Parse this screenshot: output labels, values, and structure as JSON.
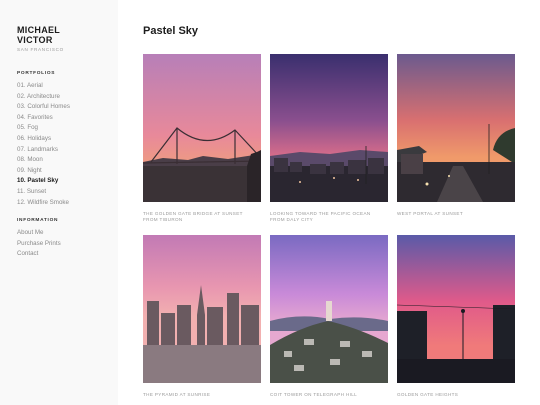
{
  "brand": {
    "line1": "MICHAEL",
    "line2": "VICTOR",
    "subtitle": "SAN FRANCISCO"
  },
  "sidebar": {
    "portfolios_heading": "PORTFOLIOS",
    "portfolios": [
      {
        "label": "01. Aerial",
        "active": false
      },
      {
        "label": "02. Architecture",
        "active": false
      },
      {
        "label": "03. Colorful Homes",
        "active": false
      },
      {
        "label": "04. Favorites",
        "active": false
      },
      {
        "label": "05. Fog",
        "active": false
      },
      {
        "label": "06. Holidays",
        "active": false
      },
      {
        "label": "07. Landmarks",
        "active": false
      },
      {
        "label": "08. Moon",
        "active": false
      },
      {
        "label": "09. Night",
        "active": false
      },
      {
        "label": "10. Pastel Sky",
        "active": true
      },
      {
        "label": "11. Sunset",
        "active": false
      },
      {
        "label": "12. Wildfire Smoke",
        "active": false
      }
    ],
    "information_heading": "INFORMATION",
    "information": [
      {
        "label": "About Me"
      },
      {
        "label": "Purchase Prints"
      },
      {
        "label": "Contact"
      }
    ]
  },
  "main": {
    "title": "Pastel Sky",
    "photos": [
      {
        "caption": "THE GOLDEN GATE BRIDGE AT SUNSET FROM TIBURON",
        "sky_top": "#b77fb8",
        "sky_mid": "#e8899a",
        "sky_bottom": "#f0a07c",
        "ground": "#3a3236"
      },
      {
        "caption": "LOOKING TOWARD THE PACIFIC OCEAN FROM DALY CITY",
        "sky_top": "#3a2f6e",
        "sky_mid": "#8a4f8e",
        "sky_bottom": "#e0708a",
        "ground": "#2a2630"
      },
      {
        "caption": "WEST PORTAL AT SUNSET",
        "sky_top": "#6b5a8e",
        "sky_mid": "#d97070",
        "sky_bottom": "#f09a6a",
        "ground": "#2f3a2e"
      },
      {
        "caption": "THE PYRAMID AT SUNRISE",
        "sky_top": "#c27ab5",
        "sky_mid": "#e896b0",
        "sky_bottom": "#f2b0b0",
        "ground": "#6a5a60"
      },
      {
        "caption": "COIT TOWER ON TELEGRAPH HILL",
        "sky_top": "#7a6ac2",
        "sky_mid": "#c98ad8",
        "sky_bottom": "#e6a8d0",
        "ground": "#4a5048"
      },
      {
        "caption": "GOLDEN GATE HEIGHTS",
        "sky_top": "#5a5aa8",
        "sky_mid": "#e05a8a",
        "sky_bottom": "#f07a7a",
        "ground": "#1e2028"
      }
    ]
  }
}
